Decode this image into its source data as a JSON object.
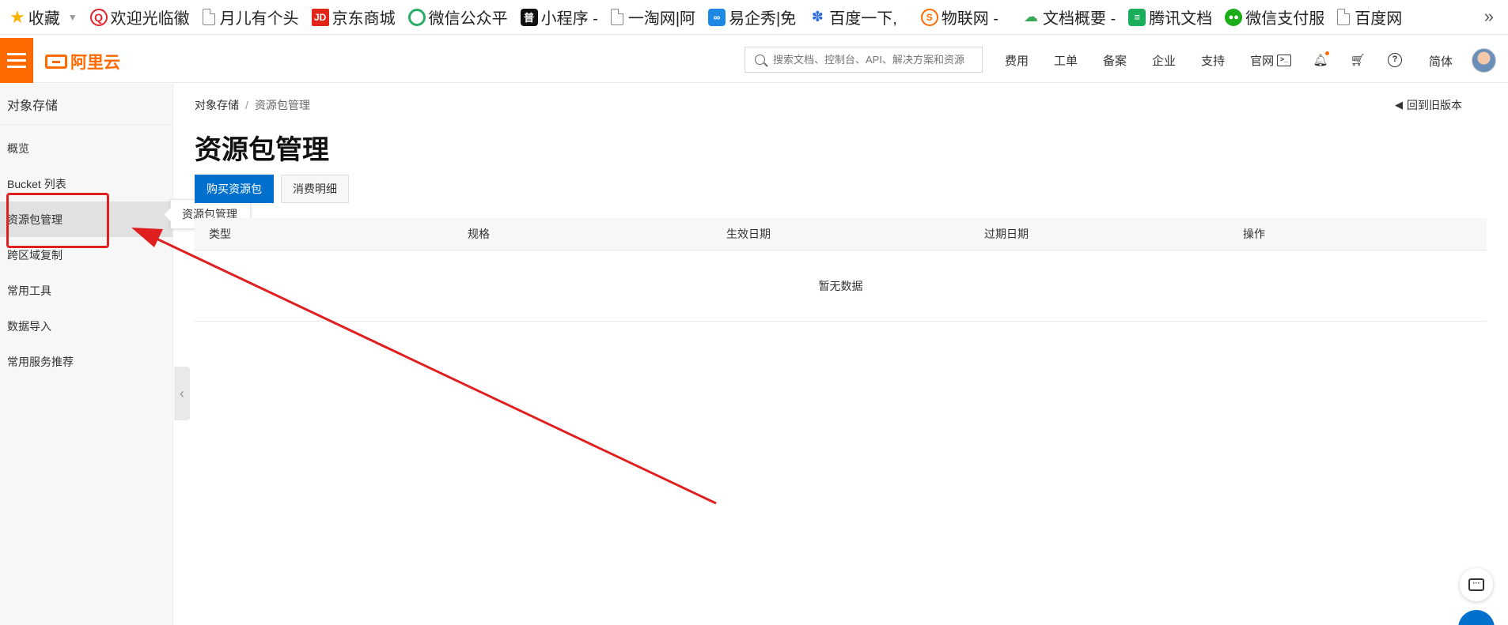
{
  "bookmarks": {
    "items": [
      {
        "label": "收藏",
        "icon": "star-icon",
        "color": "#f5b400"
      },
      {
        "label": "欢迎光临徽",
        "icon": "store-logo-icon",
        "color": "#e0242c"
      },
      {
        "label": "月儿有个头",
        "icon": "page-icon"
      },
      {
        "label": "京东商城",
        "icon": "jd-logo-icon",
        "color": "#e1251b"
      },
      {
        "label": "微信公众平",
        "icon": "wechat-mp-icon",
        "color": "#2aae67"
      },
      {
        "label": "小程序 -",
        "icon": "miniprogram-icon",
        "color": "#111111"
      },
      {
        "label": "一淘网|阿",
        "icon": "page-icon"
      },
      {
        "label": "易企秀|免",
        "icon": "eqxiu-icon",
        "color": "#1e88e5"
      },
      {
        "label": "百度一下,",
        "icon": "baidu-paw-icon",
        "color": "#2d6be4"
      },
      {
        "label": "物联网 -",
        "icon": "iot-logo-icon",
        "color": "#ff6a00"
      },
      {
        "label": "文档概要 -",
        "icon": "cloud-icon",
        "color": "#3aa757"
      },
      {
        "label": "腾讯文档",
        "icon": "sheet-icon",
        "color": "#1aad5a"
      },
      {
        "label": "微信支付服",
        "icon": "wechat-pay-icon",
        "color": "#1aad19"
      },
      {
        "label": "百度网",
        "icon": "page-icon"
      }
    ],
    "more": "»"
  },
  "header": {
    "brand": "阿里云",
    "brand_color": "#ff6a00",
    "search_placeholder": "搜索文档、控制台、API、解决方案和资源",
    "links": [
      "费用",
      "工单",
      "备案",
      "企业",
      "支持",
      "官网"
    ],
    "lang": "简体"
  },
  "sidebar": {
    "title": "对象存储",
    "items": [
      "概览",
      "Bucket 列表",
      "资源包管理",
      "跨区域复制",
      "常用工具",
      "数据导入",
      "常用服务推荐"
    ],
    "active_index": 2,
    "tooltip": "资源包管理"
  },
  "main": {
    "breadcrumb": [
      "对象存储",
      "资源包管理"
    ],
    "breadcrumb_sep": "/",
    "back_link": "回到旧版本",
    "title": "资源包管理",
    "buttons": {
      "primary": "购买资源包",
      "secondary": "消费明细"
    },
    "primary_color": "#0070cc",
    "table": {
      "columns": [
        "类型",
        "规格",
        "生效日期",
        "过期日期",
        "操作"
      ],
      "empty_text": "暂无数据"
    }
  },
  "annotation": {
    "color": "#e02020"
  }
}
